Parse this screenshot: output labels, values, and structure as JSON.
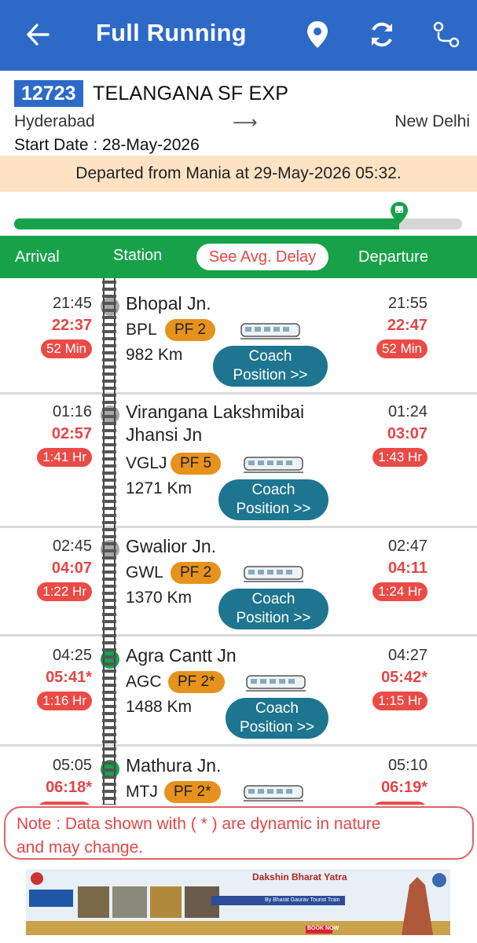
{
  "app_bar": {
    "title": "Full Running",
    "icons": [
      "back-arrow-icon",
      "location-pin-icon",
      "refresh-icon",
      "route-map-icon"
    ]
  },
  "train": {
    "number": "12723",
    "name": "TELANGANA SF EXP",
    "from": "Hyderabad",
    "to": "New Delhi",
    "arrow": "⟶",
    "start_date_label": "Start Date : ",
    "start_date": "28-May-2026"
  },
  "status": "Departed from Mania at 29-May-2026 05:32.",
  "progress_fraction": 0.86,
  "tabs": {
    "arrival": "Arrival",
    "station": "Station",
    "avg_delay": "See Avg. Delay",
    "departure": "Departure"
  },
  "stations": [
    {
      "name_line1": "Bhopal Jn.",
      "name_line2": "",
      "code": "BPL",
      "platform": "PF 2",
      "distance": "982 Km",
      "arr_sched": "21:45",
      "arr_actual": "22:37",
      "arr_delay": "52 Min",
      "dep_sched": "21:55",
      "dep_actual": "22:47",
      "dep_delay": "52 Min",
      "coach_line1": "Coach",
      "coach_line2": "Position >>",
      "status": "passed"
    },
    {
      "name_line1": "Virangana Lakshmibai",
      "name_line2": "Jhansi Jn",
      "code": "VGLJ",
      "platform": "PF 5",
      "distance": "1271 Km",
      "arr_sched": "01:16",
      "arr_actual": "02:57",
      "arr_delay": "1:41 Hr",
      "dep_sched": "01:24",
      "dep_actual": "03:07",
      "dep_delay": "1:43 Hr",
      "coach_line1": "Coach",
      "coach_line2": "Position >>",
      "status": "passed"
    },
    {
      "name_line1": "Gwalior Jn.",
      "name_line2": "",
      "code": "GWL",
      "platform": "PF 2",
      "distance": "1370 Km",
      "arr_sched": "02:45",
      "arr_actual": "04:07",
      "arr_delay": "1:22 Hr",
      "dep_sched": "02:47",
      "dep_actual": "04:11",
      "dep_delay": "1:24 Hr",
      "coach_line1": "Coach",
      "coach_line2": "Position >>",
      "status": "passed"
    },
    {
      "name_line1": "Agra Cantt Jn",
      "name_line2": "",
      "code": "AGC",
      "platform": "PF 2*",
      "distance": "1488 Km",
      "arr_sched": "04:25",
      "arr_actual": "05:41*",
      "arr_delay": "1:16 Hr",
      "dep_sched": "04:27",
      "dep_actual": "05:42*",
      "dep_delay": "1:15 Hr",
      "coach_line1": "Coach",
      "coach_line2": "Position >>",
      "status": "upcoming"
    },
    {
      "name_line1": "Mathura Jn.",
      "name_line2": "",
      "code": "MTJ",
      "platform": "PF 2*",
      "distance": "",
      "arr_sched": "05:05",
      "arr_actual": "06:18*",
      "arr_delay": "",
      "dep_sched": "05:10",
      "dep_actual": "06:19*",
      "dep_delay": "",
      "coach_line1": "",
      "coach_line2": "",
      "status": "upcoming"
    }
  ],
  "note": {
    "line1": "Note : Data shown with ( * ) are dynamic in nature",
    "line2": "and may change."
  },
  "banner": {
    "title": "Dakshin Bharat Yatra",
    "subtitle": "By Bharat Gaurav Tourist Train",
    "cta": "BOOK NOW"
  },
  "colors": {
    "app_bar": "#2d6ac7",
    "green": "#17a24a",
    "delay_red": "#ea4b46",
    "platform_orange": "#e6921c",
    "coach_button": "#1e7590",
    "status_bg": "#fde3c3"
  }
}
